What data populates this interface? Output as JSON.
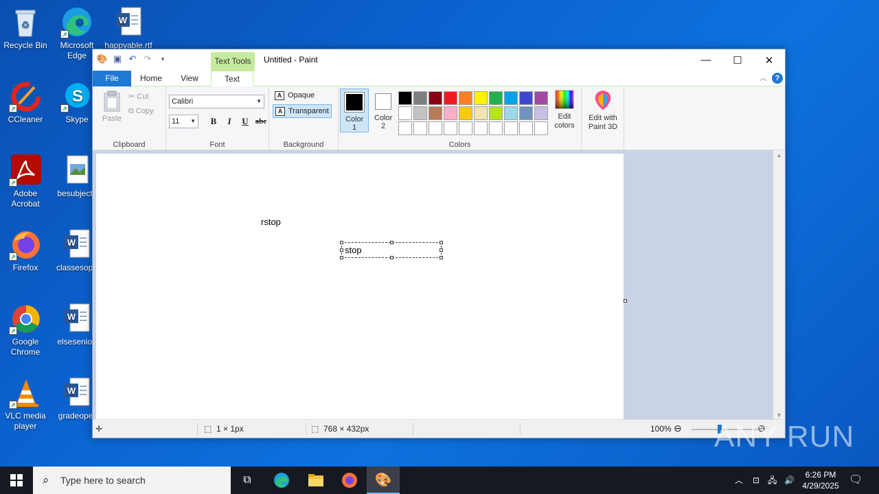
{
  "desktop": {
    "icons": [
      {
        "label": "Recycle Bin",
        "icon": "recycle-bin-icon"
      },
      {
        "label": "Microsoft Edge",
        "icon": "edge-icon"
      },
      {
        "label": "happyable.rtf",
        "icon": "word-icon"
      },
      {
        "label": "CCleaner",
        "icon": "ccleaner-icon"
      },
      {
        "label": "Skype",
        "icon": "skype-icon"
      },
      {
        "label": "Adobe Acrobat",
        "icon": "acrobat-icon"
      },
      {
        "label": "besubject.j",
        "icon": "image-file-icon"
      },
      {
        "label": "Firefox",
        "icon": "firefox-icon"
      },
      {
        "label": "classesopp",
        "icon": "word-icon"
      },
      {
        "label": "Google Chrome",
        "icon": "chrome-icon"
      },
      {
        "label": "elsesenior.",
        "icon": "word-icon"
      },
      {
        "label": "VLC media player",
        "icon": "vlc-icon"
      },
      {
        "label": "gradeoper",
        "icon": "word-icon"
      }
    ]
  },
  "window": {
    "title": "Untitled - Paint",
    "context_tab": "Text Tools",
    "tabs": [
      "File",
      "Home",
      "View",
      "Text"
    ],
    "active_tab": "Text"
  },
  "ribbon": {
    "clipboard": {
      "paste": "Paste",
      "cut": "Cut",
      "copy": "Copy",
      "label": "Clipboard"
    },
    "font": {
      "family": "Calibri",
      "size": "11",
      "bold": "B",
      "italic": "I",
      "underline": "U",
      "strike": "abc",
      "label": "Font"
    },
    "background": {
      "opaque": "Opaque",
      "transparent": "Transparent",
      "selected": "Transparent",
      "label": "Background"
    },
    "colors": {
      "color1": "Color 1",
      "color2": "Color 2",
      "edit": "Edit colors",
      "label": "Colors",
      "color1_value": "#000000",
      "color2_value": "#ffffff",
      "palette": [
        "#000000",
        "#7f7f7f",
        "#880015",
        "#ed1c24",
        "#ff7f27",
        "#fff200",
        "#22b14c",
        "#00a2e8",
        "#3f48cc",
        "#a349a4",
        "#ffffff",
        "#c3c3c3",
        "#b97a57",
        "#ffaec9",
        "#ffc90e",
        "#efe4b0",
        "#b5e61d",
        "#99d9ea",
        "#7092be",
        "#c8bfe7",
        "#ffffff",
        "#ffffff",
        "#ffffff",
        "#ffffff",
        "#ffffff",
        "#ffffff",
        "#ffffff",
        "#ffffff",
        "#ffffff",
        "#ffffff"
      ]
    },
    "paint3d": "Edit with Paint 3D"
  },
  "canvas": {
    "text_placed": "rstop",
    "text_editing": "stop"
  },
  "status": {
    "selection_size": "1 × 1px",
    "image_size": "768 × 432px",
    "zoom": "100%"
  },
  "taskbar": {
    "search_placeholder": "Type here to search",
    "time": "6:26 PM",
    "date": "4/29/2025"
  },
  "watermark": "ANY RUN"
}
